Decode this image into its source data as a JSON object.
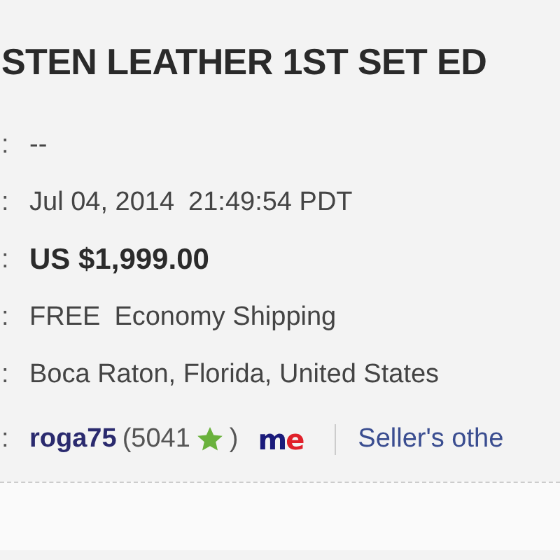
{
  "title": "STEN LEATHER 1ST SET ED",
  "rows": [
    {
      "kind": "plain",
      "mark": ":",
      "value": "--"
    },
    {
      "kind": "time",
      "mark": ":",
      "value": "Jul 04, 2014",
      "time": "21:49:54 PDT"
    },
    {
      "kind": "price",
      "mark": ":",
      "value": "US $1,999.00"
    },
    {
      "kind": "shipping",
      "mark": ":",
      "badge": "FREE",
      "value": "Economy Shipping"
    },
    {
      "kind": "plain",
      "mark": ":",
      "value": "Boca Raton, Florida, United States"
    },
    {
      "kind": "seller",
      "mark": ":",
      "seller": "roga75",
      "open": "(",
      "score": "5041",
      "close": ")",
      "logo_a": "m",
      "logo_b": "e",
      "link": "Seller's othe"
    }
  ]
}
